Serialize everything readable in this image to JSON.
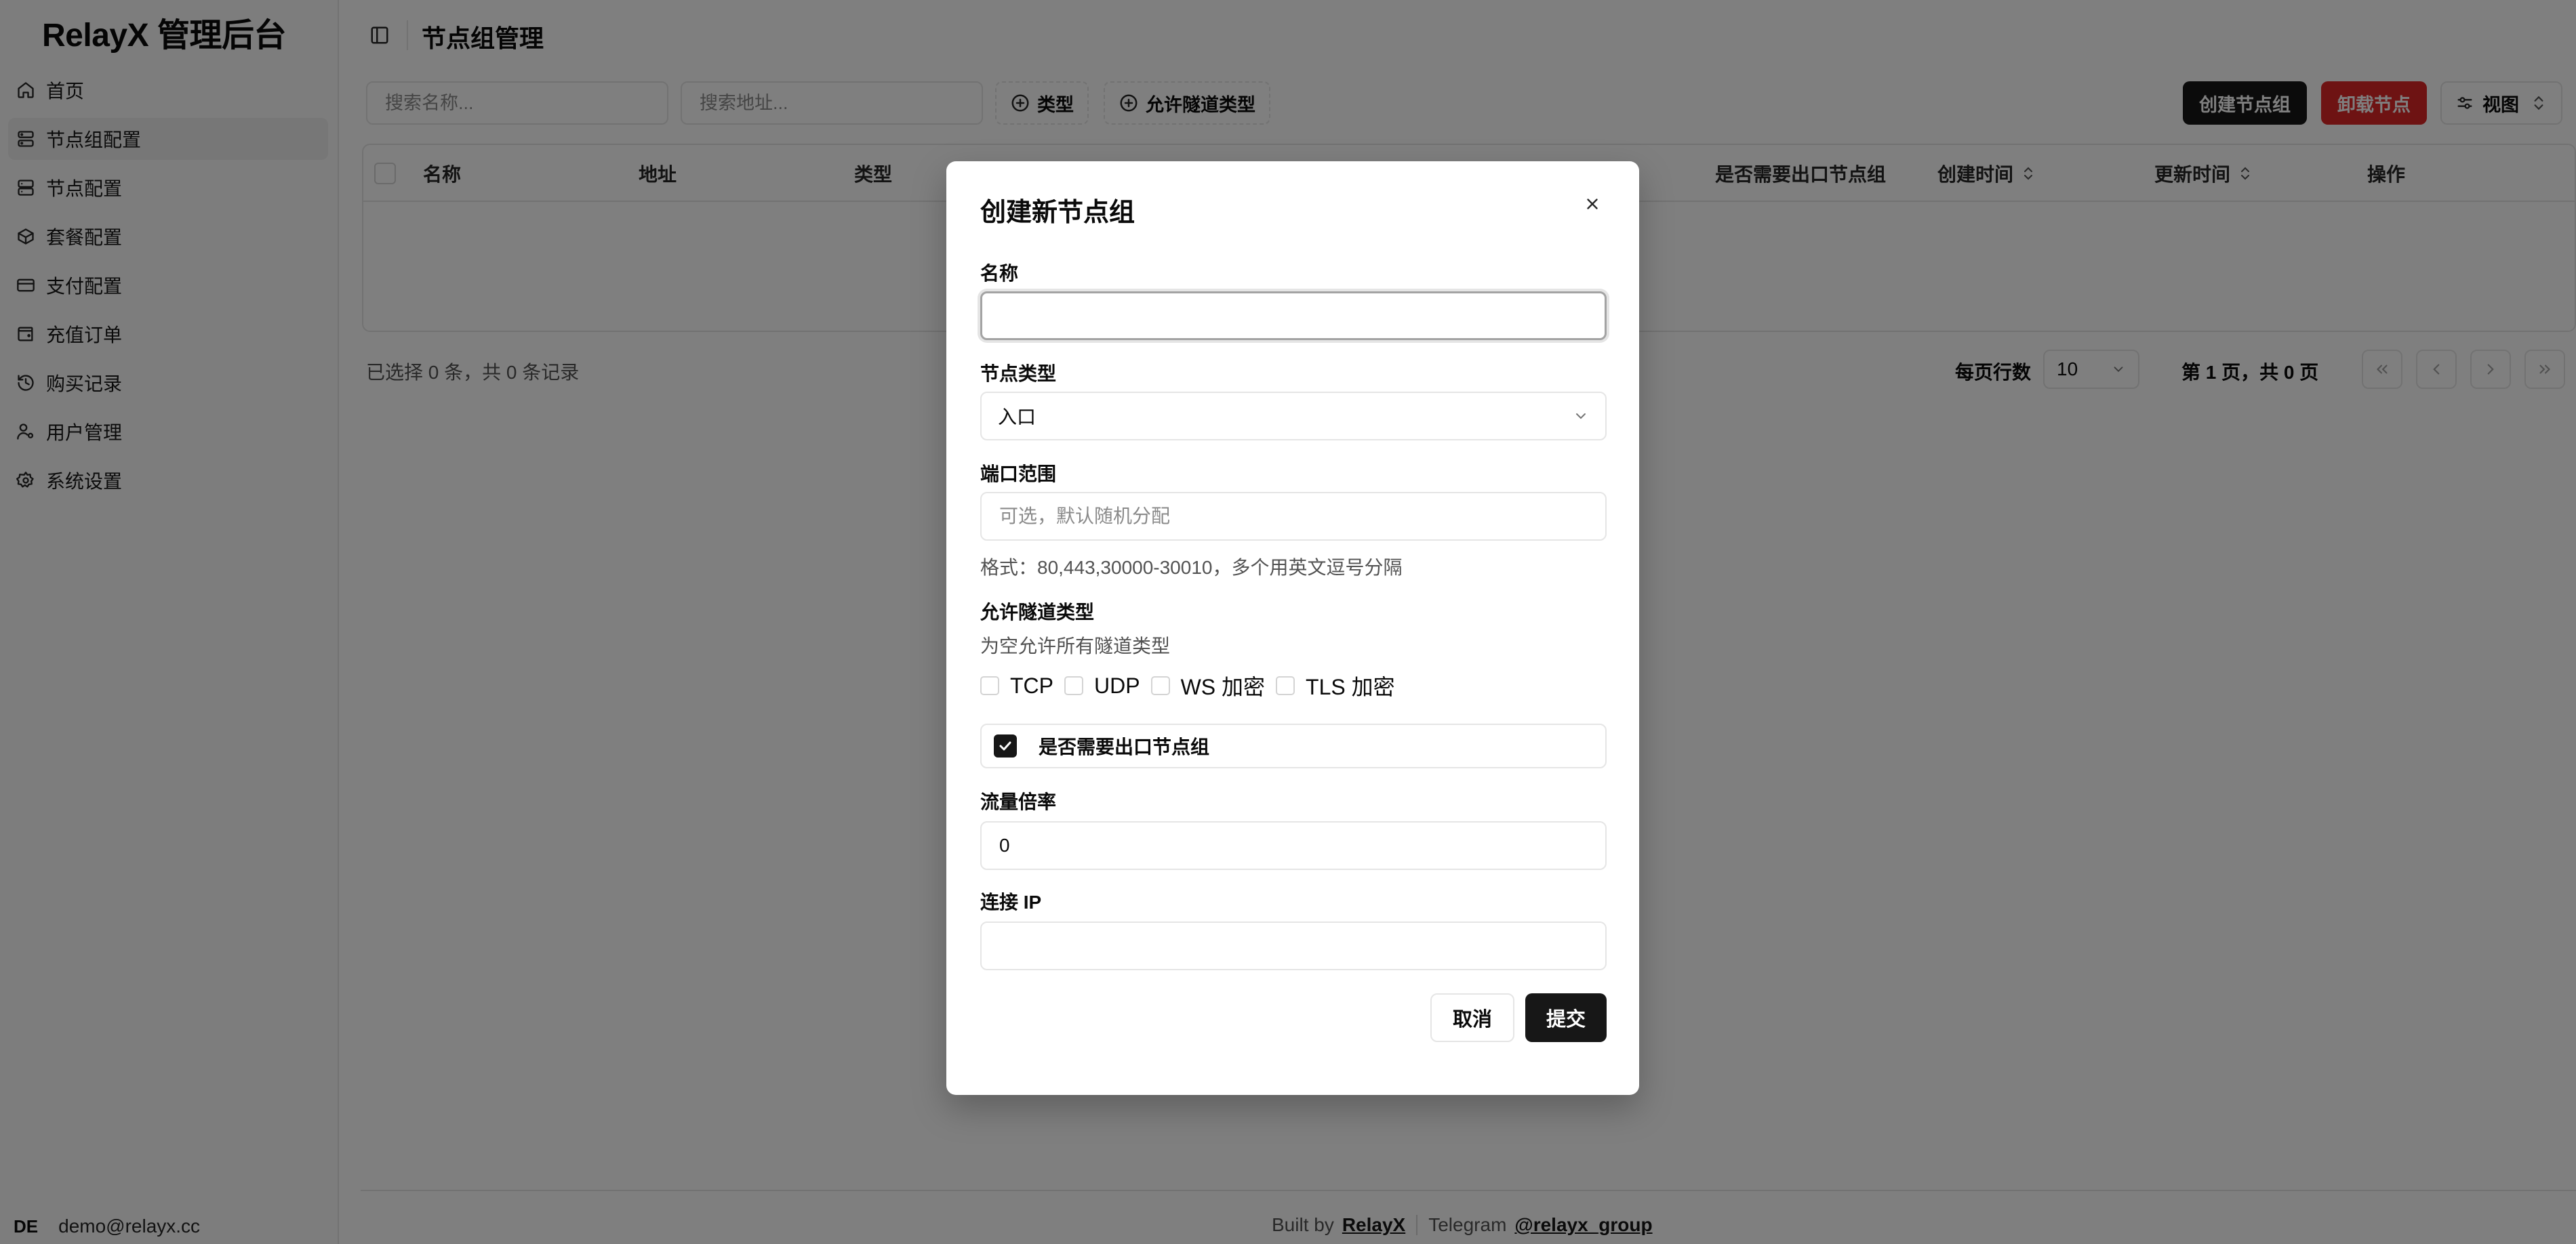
{
  "app": {
    "brand": "RelayX 管理后台"
  },
  "sidebar": {
    "items": [
      {
        "label": "首页",
        "icon": "home-icon"
      },
      {
        "label": "节点组配置",
        "icon": "server-cog-icon",
        "active": true
      },
      {
        "label": "节点配置",
        "icon": "server-icon"
      },
      {
        "label": "套餐配置",
        "icon": "package-icon"
      },
      {
        "label": "支付配置",
        "icon": "credit-card-icon"
      },
      {
        "label": "充值订单",
        "icon": "wallet-icon"
      },
      {
        "label": "购买记录",
        "icon": "history-icon"
      },
      {
        "label": "用户管理",
        "icon": "user-cog-icon"
      },
      {
        "label": "系统设置",
        "icon": "settings-icon"
      }
    ],
    "user": {
      "avatar": "DE",
      "email": "demo@relayx.cc"
    }
  },
  "header": {
    "title": "节点组管理"
  },
  "toolbar": {
    "search_name_placeholder": "搜索名称...",
    "search_address_placeholder": "搜索地址...",
    "filter_type": "类型",
    "filter_tunnel": "允许隧道类型",
    "create_button": "创建节点组",
    "unload_button": "卸载节点",
    "view_button": "视图"
  },
  "table": {
    "columns": {
      "name": "名称",
      "address": "地址",
      "type": "类型",
      "need_exit": "是否需要出口节点组",
      "created": "创建时间",
      "updated": "更新时间",
      "actions": "操作"
    }
  },
  "pagination": {
    "status": "已选择 0 条，共 0 条记录",
    "rows_per_page_label": "每页行数",
    "rows_per_page": "10",
    "page_info": "第 1 页，共 0 页"
  },
  "footer": {
    "built_by": "Built by",
    "built_by_link": "RelayX",
    "telegram": "Telegram",
    "telegram_link": "@relayx_group"
  },
  "modal": {
    "title": "创建新节点组",
    "name_label": "名称",
    "name_value": "",
    "type_label": "节点类型",
    "type_value": "入口",
    "port_label": "端口范围",
    "port_placeholder": "可选，默认随机分配",
    "port_hint": "格式：80,443,30000-30010，多个用英文逗号分隔",
    "tunnel_label": "允许隧道类型",
    "tunnel_hint": "为空允许所有隧道类型",
    "tunnel_options": [
      "TCP",
      "UDP",
      "WS 加密",
      "TLS 加密"
    ],
    "need_exit_label": "是否需要出口节点组",
    "need_exit_checked": true,
    "traffic_label": "流量倍率",
    "traffic_value": "0",
    "connect_ip_label": "连接 IP",
    "connect_ip_value": "",
    "cancel_button": "取消",
    "submit_button": "提交"
  }
}
